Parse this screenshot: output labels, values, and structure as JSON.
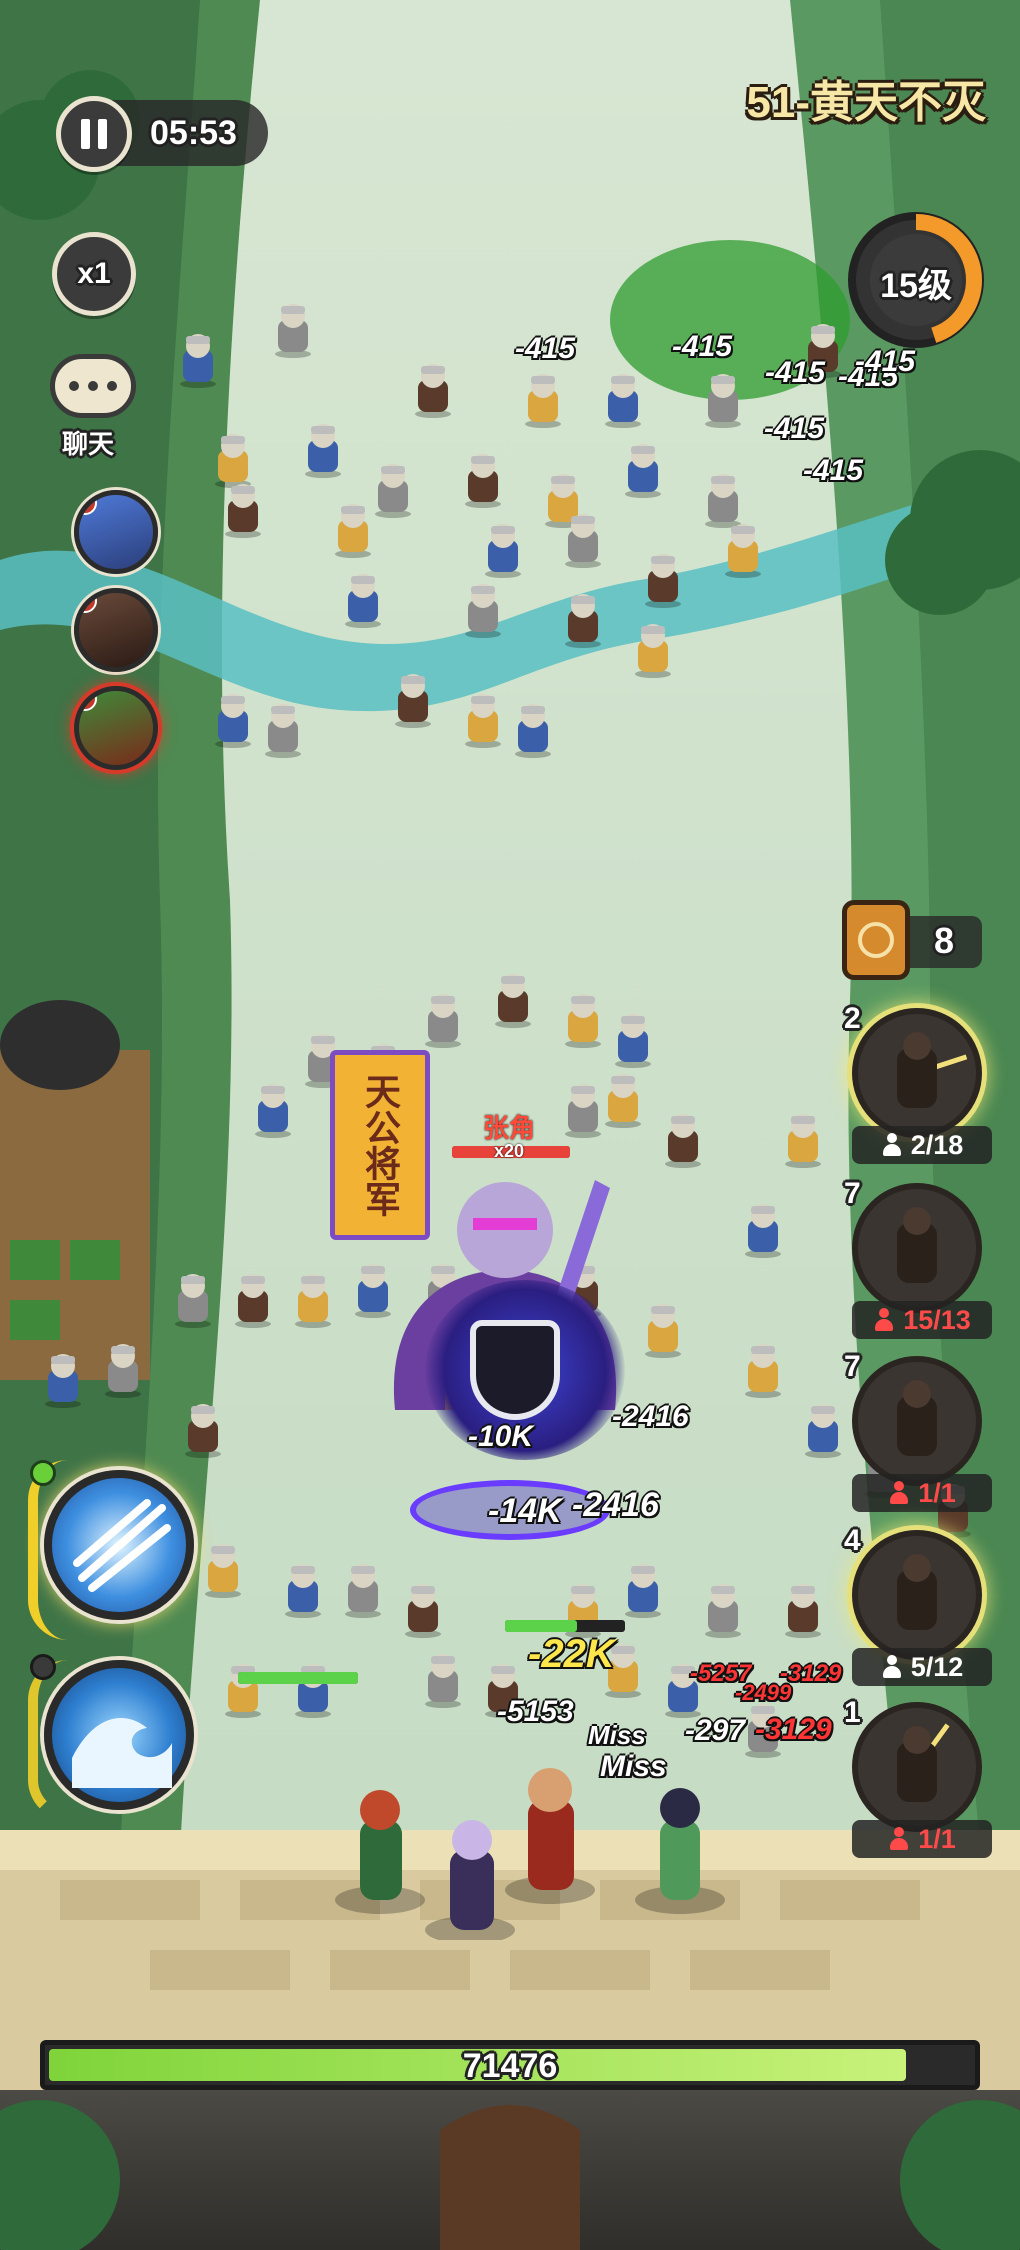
{
  "hud": {
    "timer": "05:53",
    "speed": "x1",
    "chat_label": "聊天",
    "level_title": "51-黄天不灭",
    "player_level": "15级",
    "player_level_progress": 0.45,
    "token_count": "8",
    "wall_hp": "71476",
    "wall_hp_fraction": 0.93
  },
  "boss": {
    "name": "张角",
    "stack": "x20",
    "banner_text": "天公将军"
  },
  "units": [
    {
      "level": "2",
      "count": "2/18",
      "over_cap": false,
      "cooldown": 0.2,
      "glow": true
    },
    {
      "level": "7",
      "count": "15/13",
      "over_cap": true,
      "cooldown": 0.0,
      "glow": false
    },
    {
      "level": "7",
      "count": "1/1",
      "over_cap": true,
      "cooldown": 0.0,
      "glow": false
    },
    {
      "level": "4",
      "count": "5/12",
      "over_cap": false,
      "cooldown": 0.0,
      "glow": true
    },
    {
      "level": "1",
      "count": "1/1",
      "over_cap": true,
      "cooldown": 0.1,
      "glow": false
    }
  ],
  "damage_numbers": [
    {
      "text": "-415",
      "style": "white"
    },
    {
      "text": "-415",
      "style": "white"
    },
    {
      "text": "-415",
      "style": "white"
    },
    {
      "text": "-415",
      "style": "white"
    },
    {
      "text": "-415",
      "style": "white"
    },
    {
      "text": "-415",
      "style": "white"
    },
    {
      "text": "-415",
      "style": "white"
    },
    {
      "text": "-10K",
      "style": "white"
    },
    {
      "text": "-2416",
      "style": "white"
    },
    {
      "text": "-14K",
      "style": "big"
    },
    {
      "text": "-2416",
      "style": "big"
    },
    {
      "text": "-22K",
      "style": "yellow"
    },
    {
      "text": "-5153",
      "style": "white"
    },
    {
      "text": "Miss",
      "style": "white"
    },
    {
      "text": "Miss",
      "style": "white"
    },
    {
      "text": "-297",
      "style": "white"
    },
    {
      "text": "-3129",
      "style": "red"
    },
    {
      "text": "-5257",
      "style": "red"
    },
    {
      "text": "-3129",
      "style": "red"
    },
    {
      "text": "-2499",
      "style": "red"
    }
  ],
  "colors": {
    "timer_text": "#ffffff",
    "level_ring": "#f39a2a",
    "hp_bar": "#b8f06a",
    "boss_name": "#ff4a3a",
    "over_cap": "#ff4a4a"
  }
}
